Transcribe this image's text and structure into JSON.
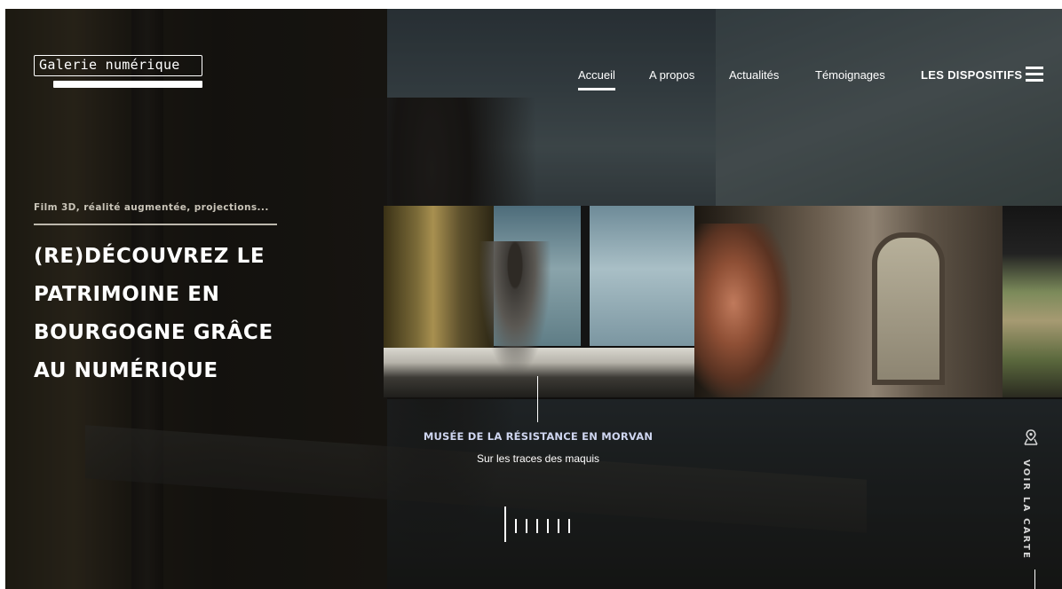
{
  "brand": {
    "logo_text": "Galerie numérique"
  },
  "nav": {
    "items": [
      {
        "label": "Accueil",
        "active": true
      },
      {
        "label": "A propos",
        "active": false
      },
      {
        "label": "Actualités",
        "active": false
      },
      {
        "label": "Témoignages",
        "active": false
      },
      {
        "label": "LES DISPOSITIFS",
        "active": false
      }
    ],
    "menu_icon": "hamburger-icon"
  },
  "hero": {
    "eyebrow": "Film 3D, réalité augmentée, projections...",
    "headline_lines": [
      "(RE)DÉCOUVREZ LE",
      "PATRIMOINE EN",
      "BOURGOGNE GRÂCE",
      "AU NUMÉRIQUE"
    ]
  },
  "carousel": {
    "active_slide": {
      "title": "MUSÉE DE LA RÉSISTANCE EN MORVAN",
      "subtitle": "Sur les traces des maquis"
    },
    "slide_count": 7,
    "active_index": 0
  },
  "map_link": {
    "label": "VOIR LA CARTE",
    "icon": "map-pin-icon"
  },
  "colors": {
    "caption_title": "#cfd6f0",
    "text": "#ffffff",
    "eyebrow": "#c9c4b8"
  }
}
